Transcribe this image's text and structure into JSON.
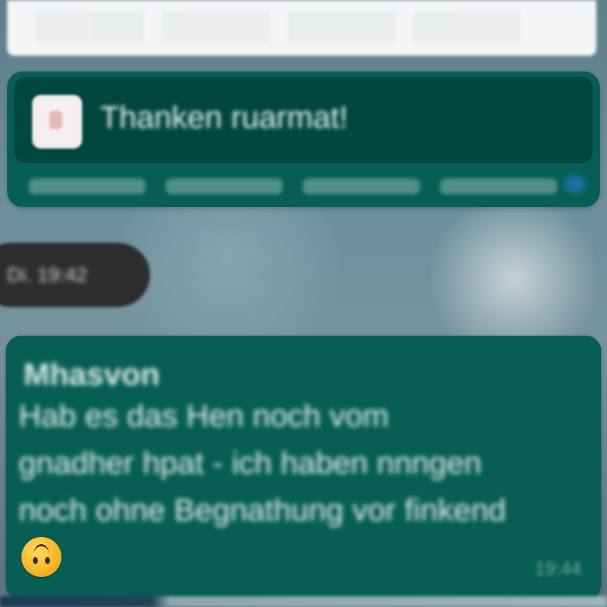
{
  "top_bar": {
    "text": ""
  },
  "reply_message": {
    "quoted_text": "Thanken ruarmat!",
    "meta_text": ""
  },
  "date_pill": {
    "label": "Di. 19:42"
  },
  "message": {
    "sender": "Mhasvon",
    "lines": [
      "Hab es das Hen noch vom",
      "gnadher hpat - ich haben nnngen",
      "noch ohne Begnathung vor finkend"
    ],
    "emoji_name": "upside-down-face-emoji",
    "time": "19:44"
  },
  "colors": {
    "bubble": "#075e54",
    "quote_bg": "#02473f",
    "date_pill": "#2d2d2d",
    "top_bar": "#f4f6f6"
  }
}
